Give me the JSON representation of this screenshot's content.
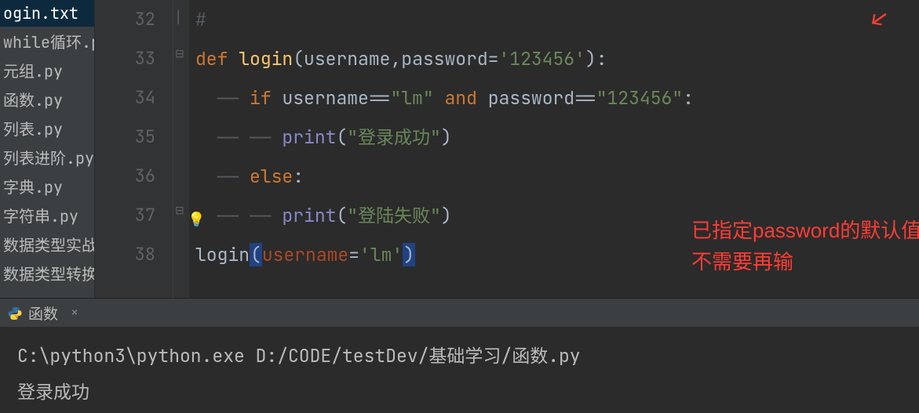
{
  "sidebar": {
    "files": [
      {
        "label": "ogin.txt",
        "active": true
      },
      {
        "label": "while循环.py",
        "active": false
      },
      {
        "label": "元组.py",
        "active": false
      },
      {
        "label": "函数.py",
        "active": false
      },
      {
        "label": "列表.py",
        "active": false
      },
      {
        "label": "列表进阶.py",
        "active": false
      },
      {
        "label": "字典.py",
        "active": false
      },
      {
        "label": "字符串.py",
        "active": false
      },
      {
        "label": "数据类型实战",
        "active": false
      },
      {
        "label": "数据类型转换",
        "active": false
      }
    ]
  },
  "gutter": {
    "start": 32,
    "lines": [
      "32",
      "33",
      "34",
      "35",
      "36",
      "37",
      "38"
    ]
  },
  "code": {
    "l32": {
      "comment": "#"
    },
    "l33": {
      "kw_def": "def",
      "fn": "login",
      "p_open": "(",
      "arg1": "username",
      "comma": ",",
      "arg2": "password",
      "eq": "=",
      "dflt": "'123456'",
      "p_close": ")",
      "colon": ":"
    },
    "l34": {
      "kw_if": "if",
      "var1": "username",
      "cmp1": "==",
      "s1": "\"lm\"",
      "kw_and": "and",
      "var2": "password",
      "cmp2": "==",
      "s2": "\"123456\"",
      "colon": ":"
    },
    "l35": {
      "fn": "print",
      "p_open": "(",
      "s": "\"登录成功\"",
      "p_close": ")"
    },
    "l36": {
      "kw_else": "else",
      "colon": ":"
    },
    "l37": {
      "fn": "print",
      "p_open": "(",
      "s": "\"登陆失败\"",
      "p_close": ")"
    },
    "l38": {
      "fn": "login",
      "p_open": "(",
      "kw": "username",
      "eq": "=",
      "s": "'lm'",
      "p_close": ")"
    }
  },
  "annotation": {
    "line1": "已指定password的默认值，就",
    "line2": "不需要再输"
  },
  "bulb_icon": "💡",
  "arrow_icon": "↙",
  "bottom": {
    "tab_label": "函数",
    "close": "×",
    "console": {
      "cmd": "C:\\python3\\python.exe D:/CODE/testDev/基础学习/函数.py",
      "out": "登录成功"
    }
  }
}
